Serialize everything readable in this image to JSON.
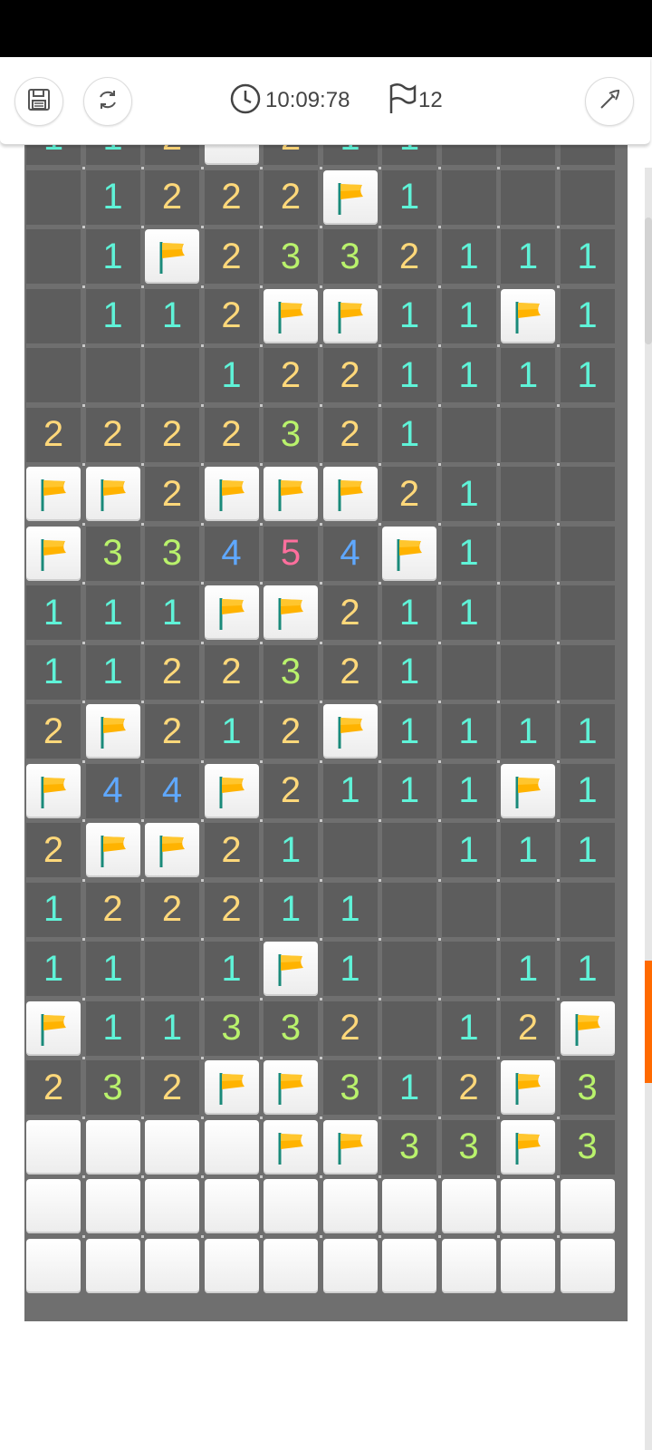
{
  "toolbar": {
    "timer": "10:09:78",
    "flag_count": "12",
    "icons": {
      "save": "save-icon",
      "restart": "restart-icon",
      "clock": "clock-icon",
      "flag": "flag-outline-icon",
      "settings": "pickaxe-icon"
    }
  },
  "colors": {
    "n1": "#5ff3d8",
    "n2": "#ffd87a",
    "n3": "#b9f26c",
    "n4": "#5fa8ff",
    "n5": "#ff6f9d",
    "revealed_bg": "#5d5d5d",
    "grid_bg": "#6f6f6f",
    "flag": "#ffb300",
    "scroll_accent": "#ff6a00"
  },
  "board": {
    "columns": 10,
    "legend": "F = flag, C = closed, E = empty revealed, digits = adjacent mine count",
    "partial_top_row": [
      "1",
      "1",
      "2",
      "C",
      "2",
      "1",
      "1",
      "E",
      "E",
      "E"
    ],
    "rows": [
      [
        "E",
        "1",
        "2",
        "2",
        "2",
        "F",
        "1",
        "E",
        "E",
        "E"
      ],
      [
        "E",
        "1",
        "F",
        "2",
        "3",
        "3",
        "2",
        "1",
        "1",
        "1"
      ],
      [
        "E",
        "1",
        "1",
        "2",
        "F",
        "F",
        "1",
        "1",
        "F",
        "1"
      ],
      [
        "E",
        "E",
        "E",
        "1",
        "2",
        "2",
        "1",
        "1",
        "1",
        "1"
      ],
      [
        "2",
        "2",
        "2",
        "2",
        "3",
        "2",
        "1",
        "E",
        "E",
        "E"
      ],
      [
        "F",
        "F",
        "2",
        "F",
        "F",
        "F",
        "2",
        "1",
        "E",
        "E"
      ],
      [
        "F",
        "3",
        "3",
        "4",
        "5",
        "4",
        "F",
        "1",
        "E",
        "E"
      ],
      [
        "1",
        "1",
        "1",
        "F",
        "F",
        "2",
        "1",
        "1",
        "E",
        "E"
      ],
      [
        "1",
        "1",
        "2",
        "2",
        "3",
        "2",
        "1",
        "E",
        "E",
        "E"
      ],
      [
        "2",
        "F",
        "2",
        "1",
        "2",
        "F",
        "1",
        "1",
        "1",
        "1"
      ],
      [
        "F",
        "4",
        "4",
        "F",
        "2",
        "1",
        "1",
        "1",
        "F",
        "1"
      ],
      [
        "2",
        "F",
        "F",
        "2",
        "1",
        "E",
        "E",
        "1",
        "1",
        "1"
      ],
      [
        "1",
        "2",
        "2",
        "2",
        "1",
        "1",
        "E",
        "E",
        "E",
        "E"
      ],
      [
        "1",
        "1",
        "E",
        "1",
        "F",
        "1",
        "E",
        "E",
        "1",
        "1"
      ],
      [
        "F",
        "1",
        "1",
        "3",
        "3",
        "2",
        "E",
        "1",
        "2",
        "F"
      ],
      [
        "2",
        "3",
        "2",
        "F",
        "F",
        "3",
        "1",
        "2",
        "F",
        "3"
      ],
      [
        "C",
        "C",
        "C",
        "C",
        "F",
        "F",
        "3",
        "3",
        "F",
        "3"
      ],
      [
        "C",
        "C",
        "C",
        "C",
        "C",
        "C",
        "C",
        "C",
        "C",
        "C"
      ],
      [
        "C",
        "C",
        "C",
        "C",
        "C",
        "C",
        "C",
        "C",
        "C",
        "C"
      ]
    ]
  }
}
